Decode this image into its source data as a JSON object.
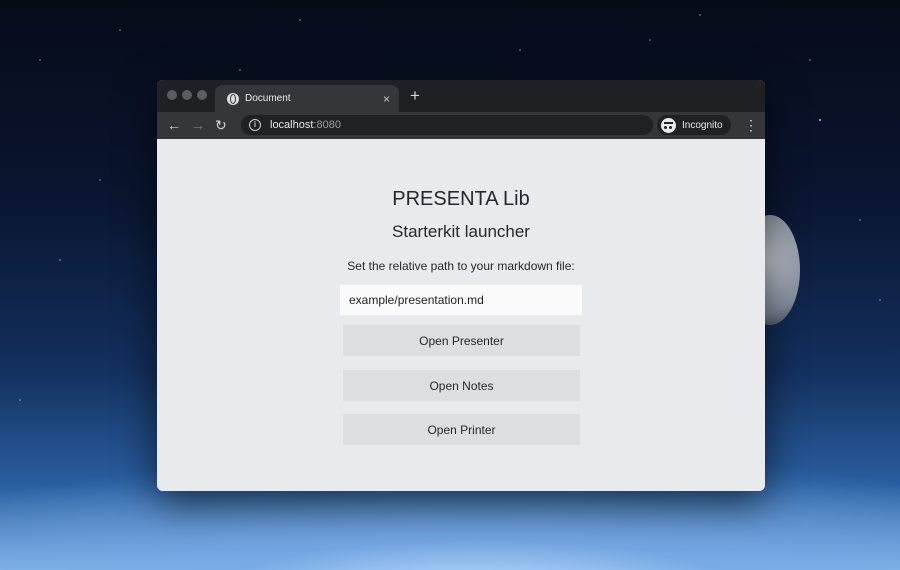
{
  "browser": {
    "tab_title": "Document",
    "tab_close": "×",
    "new_tab": "+",
    "nav": {
      "back": "←",
      "forward": "→",
      "reload": "↻"
    },
    "url_host": "localhost",
    "url_port": ":8080",
    "info_glyph": "i",
    "bookmark_glyph": "☆",
    "incognito_label": "Incognito",
    "menu_glyph": "⋮",
    "icons": [
      "globe-icon",
      "close-icon",
      "plus-icon",
      "back-arrow-icon",
      "forward-arrow-icon",
      "reload-icon",
      "info-icon",
      "star-icon",
      "incognito-icon",
      "kebab-menu-icon"
    ]
  },
  "page": {
    "title": "PRESENTA Lib",
    "subtitle": "Starterkit launcher",
    "prompt": "Set the relative path to your markdown file:",
    "path_value": "example/presentation.md",
    "buttons": {
      "presenter": "Open Presenter",
      "notes": "Open Notes",
      "printer": "Open Printer"
    }
  },
  "colors": {
    "page_bg": "#e8eaee",
    "button_bg": "#dcdee1",
    "browser_chrome": "#35363a"
  }
}
